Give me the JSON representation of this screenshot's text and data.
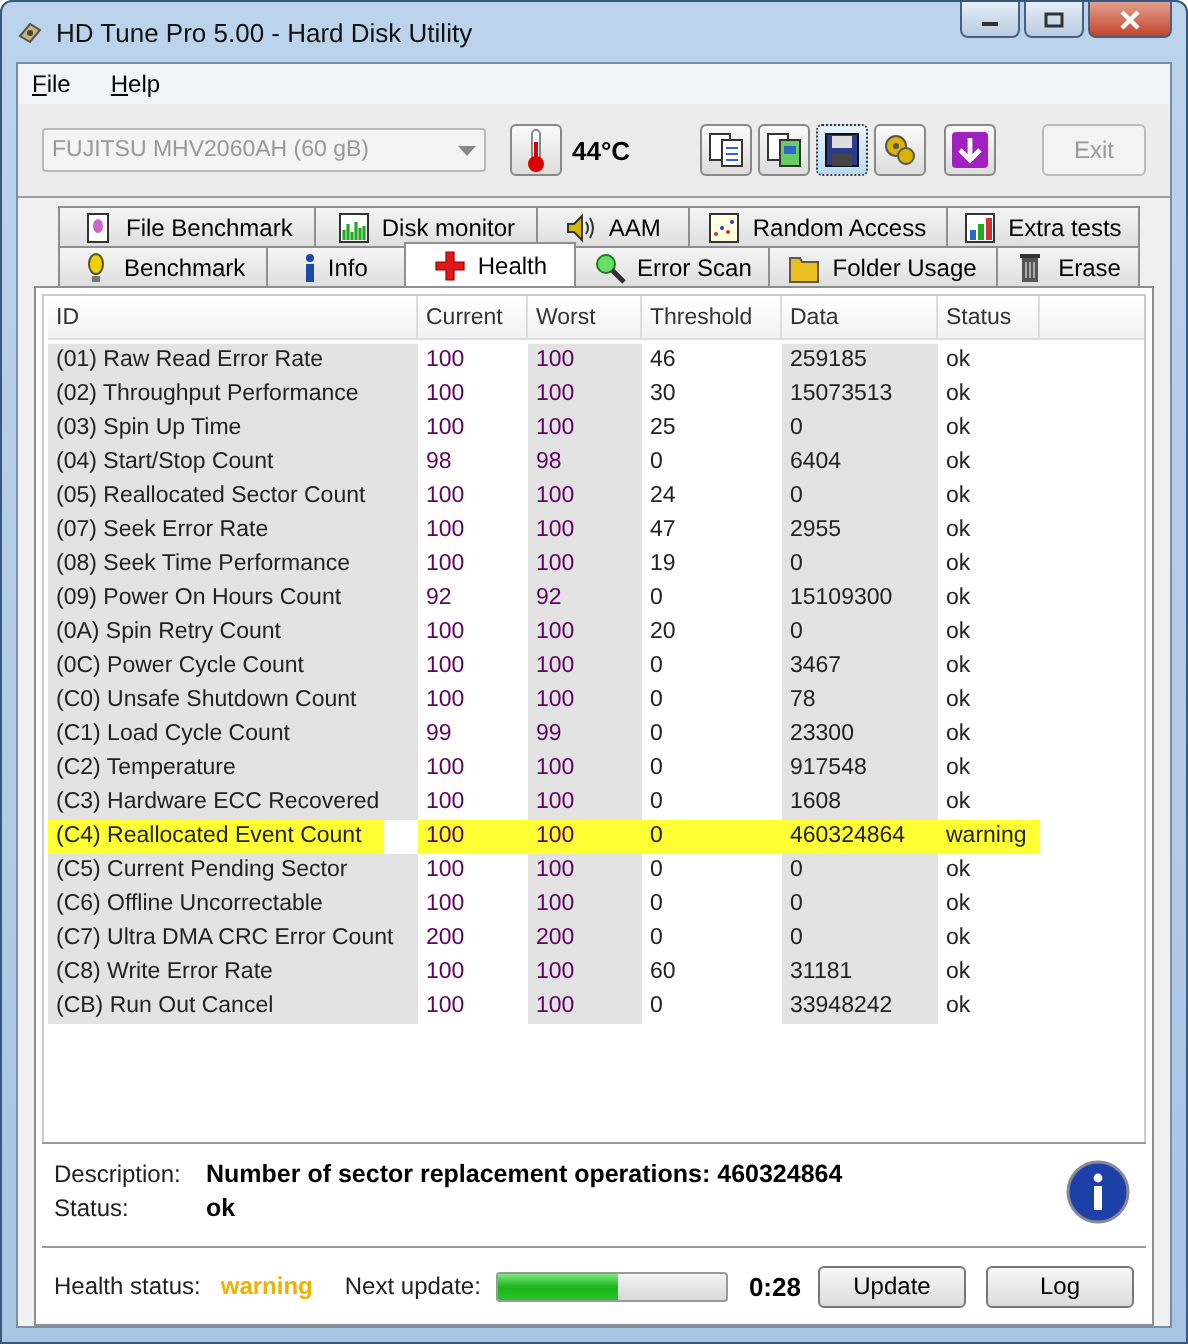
{
  "window": {
    "title": "HD Tune Pro 5.00 - Hard Disk Utility"
  },
  "menu": [
    {
      "label": "File"
    },
    {
      "label": "Help"
    }
  ],
  "toolbar": {
    "drive": "FUJITSU MHV2060AH (60 gB)",
    "temperature": "44°C",
    "exit": "Exit"
  },
  "tabs_back": [
    {
      "label": "File Benchmark",
      "selected": false
    },
    {
      "label": "Disk monitor",
      "selected": false
    },
    {
      "label": "AAM",
      "selected": false
    },
    {
      "label": "Random Access",
      "selected": false
    },
    {
      "label": "Extra tests",
      "selected": false
    }
  ],
  "tabs_front": [
    {
      "label": "Benchmark",
      "selected": false
    },
    {
      "label": "Info",
      "selected": false
    },
    {
      "label": "Health",
      "selected": true
    },
    {
      "label": "Error Scan",
      "selected": false
    },
    {
      "label": "Folder Usage",
      "selected": false
    },
    {
      "label": "Erase",
      "selected": false
    }
  ],
  "table": {
    "columns": [
      "ID",
      "Current",
      "Worst",
      "Threshold",
      "Data",
      "Status"
    ],
    "rows": [
      {
        "cells": [
          "(01) Raw Read Error Rate",
          "100",
          "100",
          "46",
          "259185",
          "ok"
        ],
        "highlighted": false
      },
      {
        "cells": [
          "(02) Throughput Performance",
          "100",
          "100",
          "30",
          "15073513",
          "ok"
        ],
        "highlighted": false
      },
      {
        "cells": [
          "(03) Spin Up Time",
          "100",
          "100",
          "25",
          "0",
          "ok"
        ],
        "highlighted": false
      },
      {
        "cells": [
          "(04) Start/Stop Count",
          "98",
          "98",
          "0",
          "6404",
          "ok"
        ],
        "highlighted": false
      },
      {
        "cells": [
          "(05) Reallocated Sector Count",
          "100",
          "100",
          "24",
          "0",
          "ok"
        ],
        "highlighted": false
      },
      {
        "cells": [
          "(07) Seek Error Rate",
          "100",
          "100",
          "47",
          "2955",
          "ok"
        ],
        "highlighted": false
      },
      {
        "cells": [
          "(08) Seek Time Performance",
          "100",
          "100",
          "19",
          "0",
          "ok"
        ],
        "highlighted": false
      },
      {
        "cells": [
          "(09) Power On Hours Count",
          "92",
          "92",
          "0",
          "15109300",
          "ok"
        ],
        "highlighted": false
      },
      {
        "cells": [
          "(0A) Spin Retry Count",
          "100",
          "100",
          "20",
          "0",
          "ok"
        ],
        "highlighted": false
      },
      {
        "cells": [
          "(0C) Power Cycle Count",
          "100",
          "100",
          "0",
          "3467",
          "ok"
        ],
        "highlighted": false
      },
      {
        "cells": [
          "(C0) Unsafe Shutdown Count",
          "100",
          "100",
          "0",
          "78",
          "ok"
        ],
        "highlighted": false
      },
      {
        "cells": [
          "(C1) Load Cycle Count",
          "99",
          "99",
          "0",
          "23300",
          "ok"
        ],
        "highlighted": false
      },
      {
        "cells": [
          "(C2) Temperature",
          "100",
          "100",
          "0",
          "917548",
          "ok"
        ],
        "highlighted": false
      },
      {
        "cells": [
          "(C3) Hardware ECC Recovered",
          "100",
          "100",
          "0",
          "1608",
          "ok"
        ],
        "highlighted": false
      },
      {
        "cells": [
          "(C4) Reallocated Event Count",
          "100",
          "100",
          "0",
          "460324864",
          "warning"
        ],
        "highlighted": true
      },
      {
        "cells": [
          "(C5) Current Pending Sector",
          "100",
          "100",
          "0",
          "0",
          "ok"
        ],
        "highlighted": false
      },
      {
        "cells": [
          "(C6) Offline Uncorrectable",
          "100",
          "100",
          "0",
          "0",
          "ok"
        ],
        "highlighted": false
      },
      {
        "cells": [
          "(C7) Ultra DMA CRC Error Count",
          "200",
          "200",
          "0",
          "0",
          "ok"
        ],
        "highlighted": false
      },
      {
        "cells": [
          "(C8) Write Error Rate",
          "100",
          "100",
          "60",
          "31181",
          "ok"
        ],
        "highlighted": false
      },
      {
        "cells": [
          "(CB) Run Out Cancel",
          "100",
          "100",
          "0",
          "33948242",
          "ok"
        ],
        "highlighted": false
      }
    ]
  },
  "details": {
    "description_label": "Description:",
    "description": "Number of sector replacement operations: 460324864",
    "status_label": "Status:",
    "status": "ok"
  },
  "status_bar": {
    "health_label": "Health status:",
    "health": "warning",
    "next_label": "Next update:",
    "level": 0.52,
    "countdown": "0:28",
    "buttons": [
      "Update",
      "Log"
    ]
  }
}
